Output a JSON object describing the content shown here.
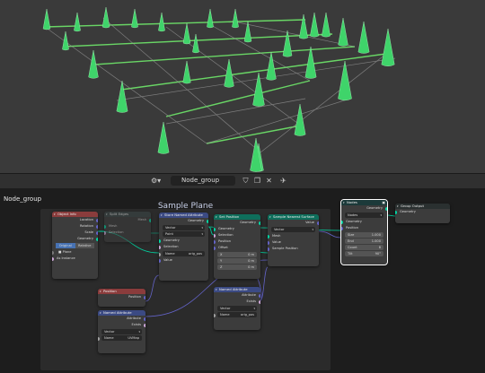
{
  "editor_header": {
    "tree_name": "Node_group"
  },
  "node_tree_label": "Node_group",
  "frame_label": "Sample Plane",
  "nodes": {
    "object_info": {
      "title": "Object Info",
      "outputs": [
        "Location",
        "Rotation",
        "Scale",
        "Geometry"
      ],
      "mode_original": "Original",
      "mode_relative": "Relative",
      "object_label": "Object",
      "object_value": "Plane",
      "as_instance": "As Instance"
    },
    "split_edges": {
      "title": "Split Edges",
      "inputs": [
        "Mesh",
        "Selection"
      ],
      "output": "Mesh"
    },
    "store_attr_1": {
      "title": "Store Named Attribute",
      "output": "Geometry",
      "domain_type": "Vector",
      "domain": "Point",
      "inputs": [
        "Geometry",
        "Selection",
        "Name",
        "Value"
      ],
      "name_value": "orig_pos"
    },
    "set_position": {
      "title": "Set Position",
      "output": "Geometry",
      "inputs": [
        "Geometry",
        "Selection",
        "Position",
        "Offset"
      ],
      "offset_x": "X",
      "offset_y": "Y",
      "offset_z": "Z",
      "offset_x_val": "0 m",
      "offset_y_val": "0 m",
      "offset_z_val": "0 m"
    },
    "sample_nearest_surface": {
      "title": "Sample Nearest Surface",
      "output": "Value",
      "type": "Vector",
      "inputs": [
        "Mesh",
        "Value",
        "Sample Position"
      ]
    },
    "named_attr_2": {
      "title": "Named Attribute",
      "outputs": [
        "Attribute",
        "Exists"
      ],
      "type": "Vector",
      "name_label": "Name",
      "name_value": "orig_pos"
    },
    "position": {
      "title": "Position",
      "output": "Position"
    },
    "named_attr_1": {
      "title": "Named Attribute",
      "outputs": [
        "Attribute",
        "Exists"
      ],
      "type": "Vector",
      "name_label": "Name",
      "name_value": "UVMap"
    },
    "nodes_group": {
      "title": "Nodes",
      "output": "Geometry",
      "group_name": "Nodes",
      "input_geometry": "Geometry",
      "input_position": "Position",
      "fields": [
        {
          "label": "Size",
          "value": "1.000"
        },
        {
          "label": "End",
          "value": "1.000"
        },
        {
          "label": "Count",
          "value": "8"
        },
        {
          "label": "Tilt",
          "value": "90°"
        }
      ]
    },
    "group_output": {
      "title": "Group Output",
      "input": "Geometry"
    }
  },
  "colors": {
    "cone": "#3fd46a",
    "wire": "#6fe86a",
    "viewport_bg": "#3a3a3a",
    "node_bg": "#3c3c3c",
    "geometry_socket": "#00d6a3",
    "vector_socket": "#6363c7",
    "float_socket": "#a1a1a1",
    "boolean_socket": "#cca6d6"
  }
}
